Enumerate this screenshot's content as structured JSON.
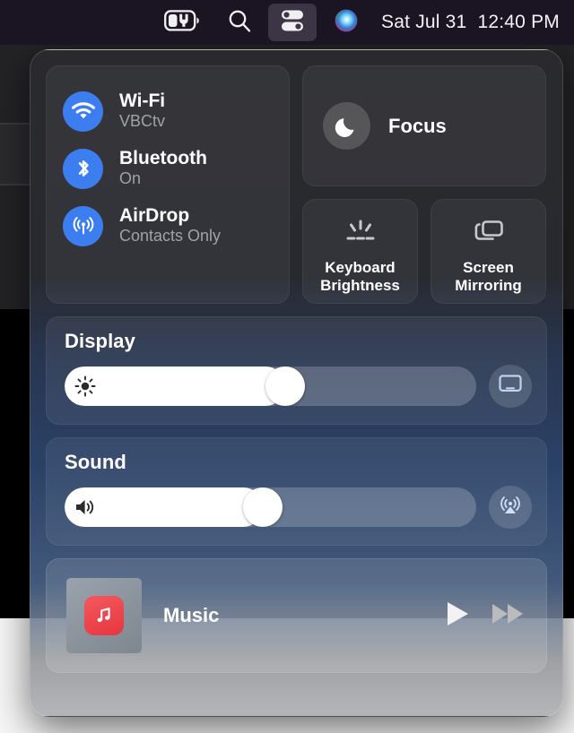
{
  "menubar": {
    "items": [
      {
        "name": "battery-charging-icon",
        "label": "Battery Charging"
      },
      {
        "name": "search-icon",
        "label": "Spotlight Search"
      },
      {
        "name": "control-center-icon",
        "label": "Control Center"
      },
      {
        "name": "siri-icon",
        "label": "Siri"
      }
    ],
    "clock": "Sat Jul 31  12:40 PM"
  },
  "control_center": {
    "connectivity": [
      {
        "icon": "wifi-icon",
        "title": "Wi-Fi",
        "subtitle": "VBCtv"
      },
      {
        "icon": "bluetooth-icon",
        "title": "Bluetooth",
        "subtitle": "On"
      },
      {
        "icon": "airdrop-icon",
        "title": "AirDrop",
        "subtitle": "Contacts Only"
      }
    ],
    "focus": {
      "icon": "moon-icon",
      "label": "Focus"
    },
    "tiles": [
      {
        "icon": "keyboard-brightness-icon",
        "label": "Keyboard\nBrightness",
        "line1": "Keyboard",
        "line2": "Brightness"
      },
      {
        "icon": "screen-mirroring-icon",
        "label": "Screen\nMirroring",
        "line1": "Screen",
        "line2": "Mirroring"
      }
    ],
    "display": {
      "title": "Display",
      "slider_glyph": "brightness-sun-icon",
      "value_percent": 54,
      "side_button_icon": "display-monitor-icon"
    },
    "sound": {
      "title": "Sound",
      "slider_glyph": "speaker-volume-icon",
      "value_percent": 48,
      "side_button_icon": "airplay-audio-icon"
    },
    "music": {
      "app_icon": "music-app-icon",
      "title": "Music",
      "controls": [
        {
          "name": "play-button",
          "icon": "play-icon"
        },
        {
          "name": "fast-forward-button",
          "icon": "fast-forward-icon"
        }
      ]
    }
  },
  "colors": {
    "accent_blue": "#3c7ef0",
    "music_red": "#e7363f",
    "panel_dark": "#2a2a2e",
    "menubar": "#1b1423"
  }
}
